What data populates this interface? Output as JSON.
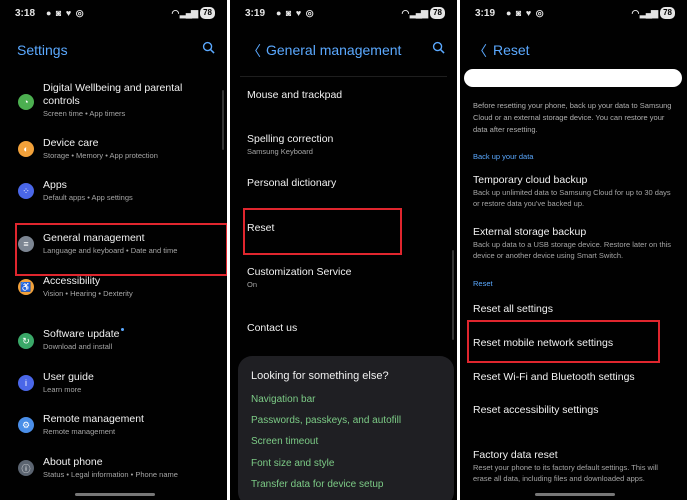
{
  "colors": {
    "accent": "#5ba9ff",
    "highlight": "#e0262e",
    "link_green": "#7ccb86"
  },
  "status_bar": [
    {
      "time": "3:18",
      "battery": "78"
    },
    {
      "time": "3:19",
      "battery": "78"
    },
    {
      "time": "3:19",
      "battery": "78"
    }
  ],
  "settings": {
    "title": "Settings",
    "items": [
      {
        "title": "Digital Wellbeing and parental controls",
        "subtitle": "Screen time  •  App timers",
        "icon": "wellbeing-icon",
        "color": "#4caf50"
      },
      {
        "title": "Device care",
        "subtitle": "Storage  •  Memory  •  App protection",
        "icon": "device-care-icon",
        "color": "#f2a13a"
      },
      {
        "title": "Apps",
        "subtitle": "Default apps  •  App settings",
        "icon": "apps-icon",
        "color": "#4a67e8"
      },
      {
        "title": "General management",
        "subtitle": "Language and keyboard  •  Date and time",
        "icon": "general-management-icon",
        "color": "#7c8592"
      },
      {
        "title": "Accessibility",
        "subtitle": "Vision  •  Hearing  •  Dexterity",
        "icon": "accessibility-icon",
        "color": "#f2a13a"
      },
      {
        "title": "Software update",
        "subtitle": "Download and install",
        "icon": "software-update-icon",
        "color": "#3aa868"
      },
      {
        "title": "User guide",
        "subtitle": "Learn more",
        "icon": "user-guide-icon",
        "color": "#4a67e8"
      },
      {
        "title": "Remote management",
        "subtitle": "Remote management",
        "icon": "remote-management-icon",
        "color": "#4a8ee8"
      },
      {
        "title": "About phone",
        "subtitle": "Status  •  Legal information  •  Phone name",
        "icon": "about-phone-icon",
        "color": "#5b6470"
      }
    ]
  },
  "general": {
    "title": "General management",
    "items": [
      {
        "title": "Mouse and trackpad",
        "subtitle": ""
      },
      {
        "title": "Spelling correction",
        "subtitle": "Samsung Keyboard"
      },
      {
        "title": "Personal dictionary",
        "subtitle": ""
      },
      {
        "title": "Reset",
        "subtitle": ""
      },
      {
        "title": "Customization Service",
        "subtitle": "On"
      },
      {
        "title": "Contact us",
        "subtitle": ""
      }
    ],
    "card": {
      "heading": "Looking for something else?",
      "links": [
        "Navigation bar",
        "Passwords, passkeys, and autofill",
        "Screen timeout",
        "Font size and style",
        "Transfer data for device setup"
      ]
    }
  },
  "reset": {
    "title": "Reset",
    "intro": "Before resetting your phone, back up your data to Samsung Cloud or an external storage device. You can restore your data after resetting.",
    "backup_section": "Back up your data",
    "backup_items": [
      {
        "title": "Temporary cloud backup",
        "subtitle": "Back up unlimited data to Samsung Cloud for up to 30 days or restore data you've backed up."
      },
      {
        "title": "External storage backup",
        "subtitle": "Back up data to a USB storage device. Restore later on this device or another device using Smart Switch."
      }
    ],
    "reset_section": "Reset",
    "reset_items": [
      "Reset all settings",
      "Reset mobile network settings",
      "Reset Wi-Fi and Bluetooth settings",
      "Reset accessibility settings"
    ],
    "factory": {
      "title": "Factory data reset",
      "subtitle": "Reset your phone to its factory default settings. This will erase all data, including files and downloaded apps."
    }
  }
}
